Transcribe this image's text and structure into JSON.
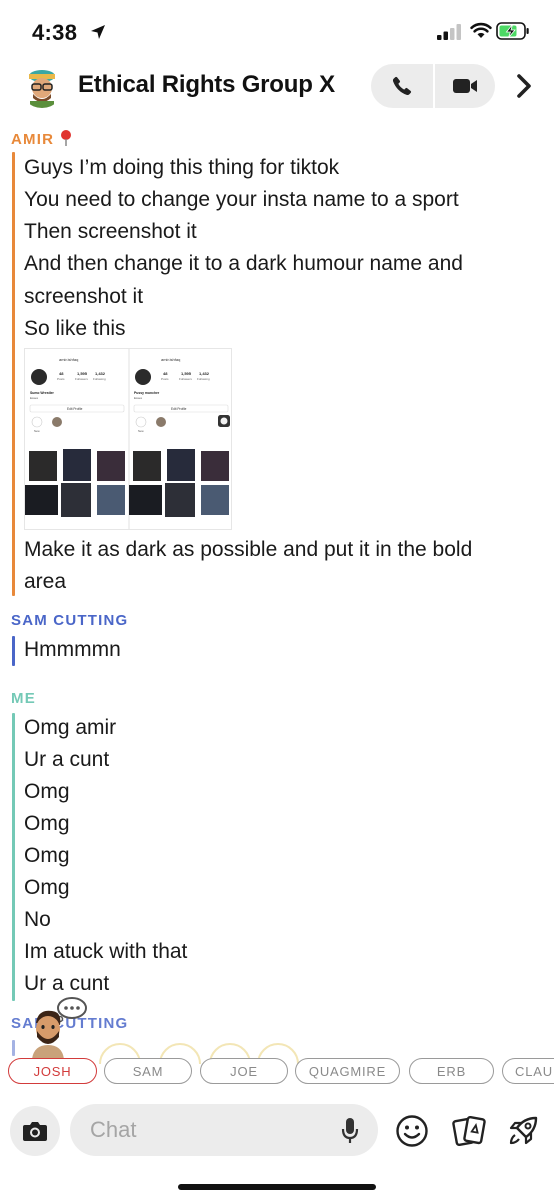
{
  "status_bar": {
    "time": "4:38",
    "icons": [
      "location-arrow-icon",
      "cellular-signal-icon",
      "wifi-icon",
      "battery-charging-icon"
    ]
  },
  "header": {
    "title": "Ethical Rights Group X",
    "icons": [
      "group-bitmoji-avatar",
      "phone-icon",
      "video-camera-icon",
      "chevron-right-icon"
    ]
  },
  "messages": {
    "amir": {
      "sender": "AMIR",
      "emoji_icon": "round-pushpin-icon",
      "lines": [
        "Guys I’m doing this thing for tiktok",
        "You need to change your insta name to a sport",
        "Then screenshot it",
        "And then change it to a dark humour name and",
        "screenshot it",
        "So like this"
      ],
      "lines_after_image": [
        "Make it as dark as possible and put it in the bold",
        "area"
      ],
      "image": {
        "left": {
          "username": "amir.ishfaq",
          "name": "Sumo Wrestler",
          "bio": "Essex",
          "posts": "48",
          "posts_label": "Posts",
          "followers": "1,595",
          "followers_label": "Followers",
          "following": "1,432",
          "following_label": "Following",
          "edit_label": "Edit Profile",
          "new_label": "New"
        },
        "right": {
          "username": "amir.ishfaq",
          "name": "Pussy muncher",
          "bio": "Essex",
          "posts": "48",
          "posts_label": "Posts",
          "followers": "1,595",
          "followers_label": "Followers",
          "following": "1,432",
          "following_label": "Following",
          "edit_label": "Edit Profile",
          "new_label": "New"
        }
      }
    },
    "sam1": {
      "sender": "SAM CUTTING",
      "lines": [
        "Hmmmmn"
      ]
    },
    "me": {
      "sender": "ME",
      "lines": [
        "Omg amir",
        "Ur a cunt",
        "Omg",
        "Omg",
        "Omg",
        "Omg",
        "No",
        "Im atuck with that",
        "Ur a cunt"
      ]
    },
    "sam2": {
      "sender": "SAM CUTTING"
    }
  },
  "chips": [
    {
      "label": "JOSH",
      "active": true
    },
    {
      "label": "SAM",
      "active": false
    },
    {
      "label": "JOE",
      "active": false
    },
    {
      "label": "QUAGMIRE",
      "active": false
    },
    {
      "label": "ERB",
      "active": false
    },
    {
      "label": "CLAU",
      "active": false
    }
  ],
  "composer": {
    "placeholder": "Chat",
    "icons": [
      "camera-icon",
      "microphone-icon",
      "emoji-icon",
      "cards-icon",
      "rocket-icon"
    ]
  },
  "colors": {
    "amir": "#e8893a",
    "sam": "#4a66c8",
    "me": "#74c9b6",
    "chip_active": "#d23b3b"
  }
}
